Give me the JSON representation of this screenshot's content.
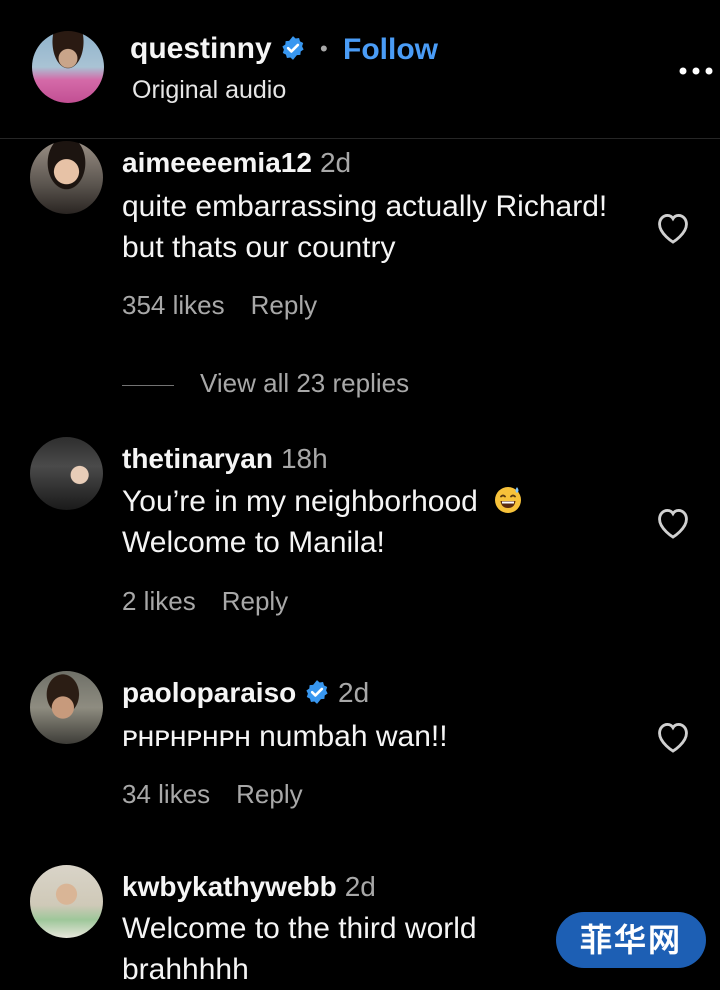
{
  "header": {
    "username": "questinny",
    "separator": "•",
    "follow_label": "Follow",
    "subtitle": "Original audio",
    "more_label": "•••"
  },
  "comments": [
    {
      "username": "aimeeeemia12",
      "time": "2d",
      "verified": false,
      "lines": [
        "quite embarrassing actually Richard!",
        "but thats our country"
      ],
      "likes": "354 likes",
      "reply": "Reply"
    },
    {
      "username": "thetinaryan",
      "time": "18h",
      "verified": false,
      "lines": [
        "You’re in my neighborhood",
        "Welcome to Manila!"
      ],
      "emoji": "grinning-sweat-emoji",
      "likes": "2 likes",
      "reply": "Reply"
    },
    {
      "username": "paoloparaiso",
      "time": "2d",
      "verified": true,
      "lines": [
        "ᴘʜᴘʜᴘʜᴘʜ numbah wan!!"
      ],
      "likes": "34 likes",
      "reply": "Reply"
    },
    {
      "username": "kwbykathywebb",
      "time": "2d",
      "verified": false,
      "lines": [
        "Welcome to the third world",
        "brahhhhh"
      ]
    }
  ],
  "view_replies": "View all 23 replies",
  "watermark": {
    "badge_text": "菲华网"
  },
  "colors": {
    "background": "#000000",
    "follow": "#4a9cf6",
    "verified": "#3897f0",
    "muted": "#a8a8a8",
    "watermark_badge": "#1d5fb4"
  },
  "icons": [
    "verified-badge-icon",
    "more-options-icon",
    "heart-icon"
  ]
}
